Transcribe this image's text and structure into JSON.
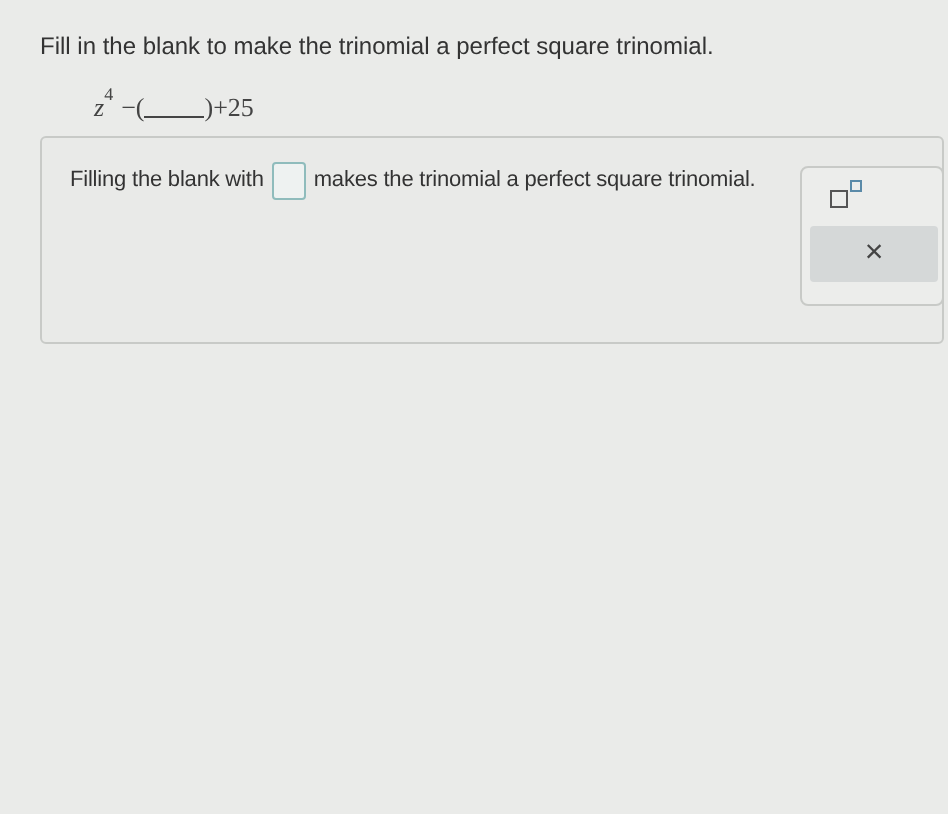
{
  "question": "Fill in the blank to make the trinomial a perfect square trinomial.",
  "expression": {
    "base": "z",
    "exponent": "4",
    "before_blank": "−(",
    "after_blank": ")+25"
  },
  "answer": {
    "before": "Filling the blank with",
    "after": "makes the trinomial a perfect square trinomial."
  },
  "palette": {
    "close": "×"
  }
}
